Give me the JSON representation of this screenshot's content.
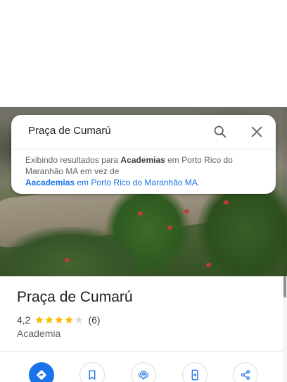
{
  "search": {
    "query": "Praça de Cumarú"
  },
  "suggestion": {
    "prefix": "Exibindo resultados para ",
    "corrected_term": "Academias",
    "corrected_location": " em Porto Rico do Maranhão MA em vez de",
    "original_term": "Aacademias",
    "original_location": " em Porto Rico do Maranhão MA",
    "period": "."
  },
  "place": {
    "title": "Praça de Cumarú",
    "rating": "4,2",
    "stars_filled": 4,
    "stars_total": 5,
    "reviews": "(6)",
    "category": "Academia"
  },
  "icons": {
    "search": "search-icon",
    "close": "close-icon",
    "directions": "directions-icon",
    "save": "bookmark-icon",
    "nearby": "nearby-icon",
    "send_to_phone": "send-to-phone-icon",
    "share": "share-icon"
  },
  "colors": {
    "accent": "#1a73e8",
    "star": "#fbbc04",
    "star_empty": "#dadce0"
  }
}
